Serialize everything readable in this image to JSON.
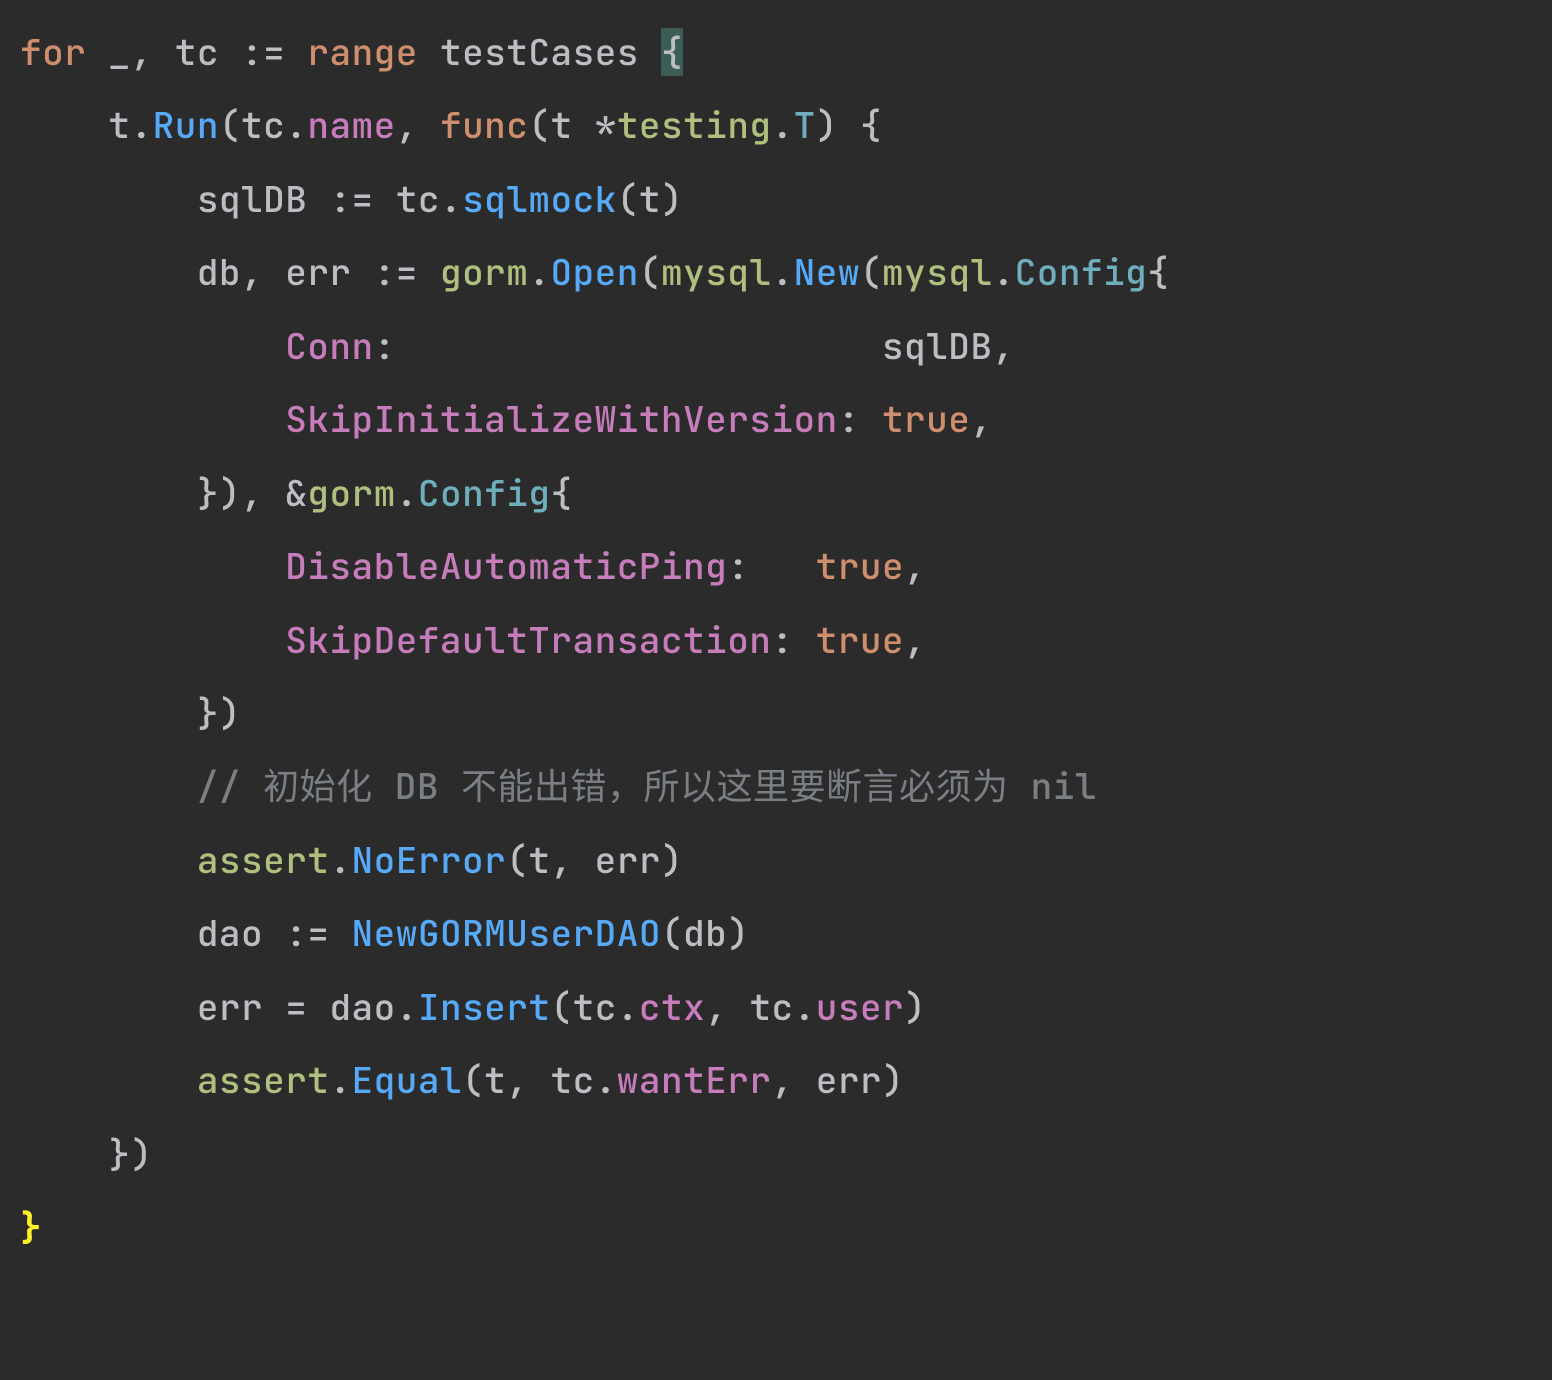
{
  "tokens": {
    "for": "for",
    "underscore": "_",
    "comma": ",",
    "tc": "tc",
    "colon_eq": ":=",
    "range": "range",
    "testCases": "testCases",
    "lbrace_caret": "{",
    "t": "t",
    "dot": ".",
    "Run": "Run",
    "lpar": "(",
    "name": "name",
    "func": "func",
    "star": "*",
    "testing": "testing",
    "T": "T",
    "rpar": ")",
    "lbrace": "{",
    "sqlDB": "sqlDB",
    "sqlmock": "sqlmock",
    "db": "db",
    "err": "err",
    "gorm": "gorm",
    "Open": "Open",
    "mysql": "mysql",
    "New": "New",
    "Config": "Config",
    "Conn": "Conn",
    "colon": ":",
    "SkipInitializeWithVersion": "SkipInitializeWithVersion",
    "true": "true",
    "rbrace": "}",
    "amp": "&",
    "DisableAutomaticPing": "DisableAutomaticPing",
    "SkipDefaultTransaction": "SkipDefaultTransaction",
    "comment_db": "// 初始化 DB 不能出错，所以这里要断言必须为 nil",
    "assert": "assert",
    "NoError": "NoError",
    "dao": "dao",
    "NewGORMUserDAO": "NewGORMUserDAO",
    "eq": "=",
    "Insert": "Insert",
    "ctx": "ctx",
    "user": "user",
    "Equal": "Equal",
    "wantErr": "wantErr",
    "rbrace_hl": "}"
  }
}
